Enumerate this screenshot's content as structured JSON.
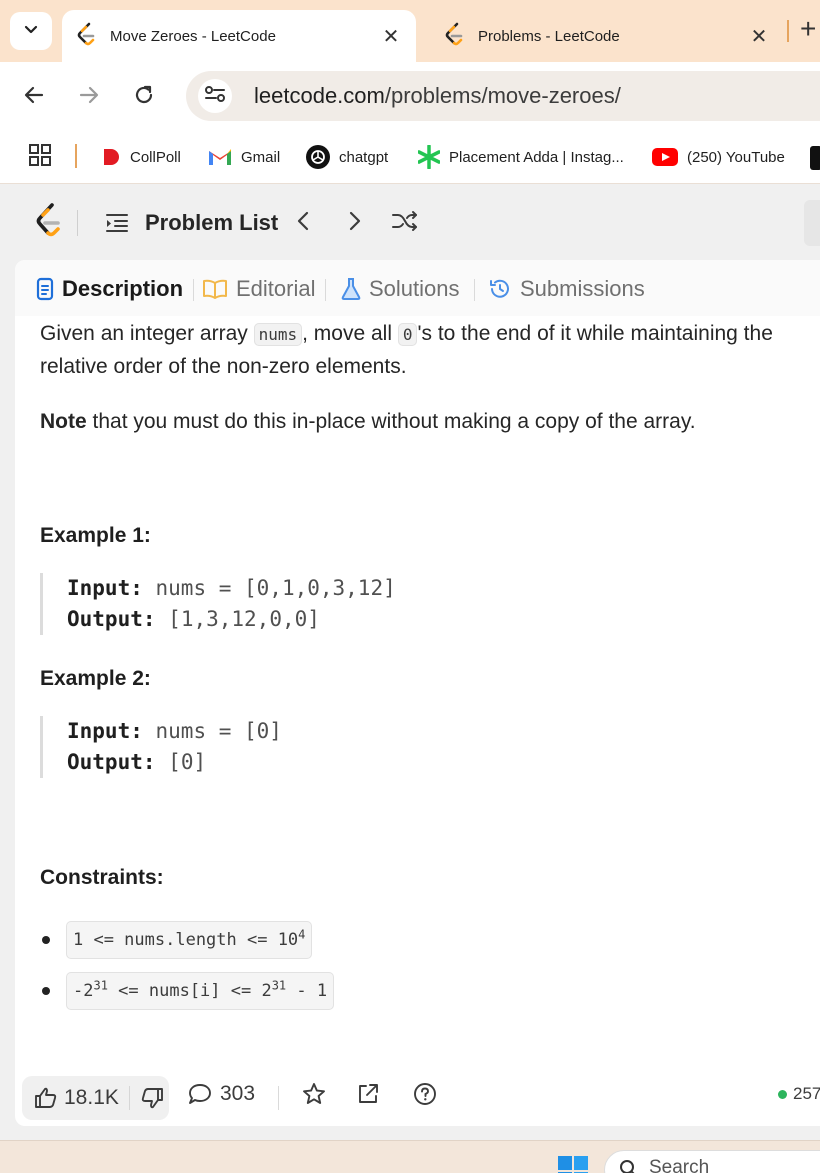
{
  "browser": {
    "tabs": [
      {
        "title": "Move Zeroes - LeetCode",
        "close": "✕"
      },
      {
        "title": "Problems - LeetCode",
        "close": "✕"
      }
    ],
    "new_tab": "+",
    "url_domain": "leetcode.com",
    "url_path": "/problems/move-zeroes/",
    "bookmarks": [
      "CollPoll",
      "Gmail",
      "chatgpt",
      "Placement Adda | Instag...",
      "(250) YouTube"
    ]
  },
  "leetcode": {
    "problem_list_label": "Problem List",
    "tabs": [
      "Description",
      "Editorial",
      "Solutions",
      "Submissions"
    ],
    "description": {
      "p1_a": "Given an integer array ",
      "p1_code1": "nums",
      "p1_b": ", move all ",
      "p1_code2": "0",
      "p1_c": "'s to the end of it while maintaining the relative order of the non-zero elements.",
      "note_bold": "Note",
      "note_rest": " that you must do this in-place without making a copy of the array."
    },
    "examples": [
      {
        "heading": "Example 1:",
        "input_label": "Input:",
        "input": "nums = [0,1,0,3,12]",
        "output_label": "Output:",
        "output": "[1,3,12,0,0]"
      },
      {
        "heading": "Example 2:",
        "input_label": "Input:",
        "input": "nums = [0]",
        "output_label": "Output:",
        "output": "[0]"
      }
    ],
    "constraints_heading": "Constraints:",
    "constraints": [
      {
        "pre": "1 <= nums.length <= 10",
        "sup": "4",
        "post": ""
      },
      {
        "pre": "-2",
        "sup": "31",
        "mid": " <= nums[i] <= 2",
        "sup2": "31",
        "post": " - 1"
      }
    ],
    "likes": "18.1K",
    "comments": "303",
    "online_count": "257"
  },
  "taskbar": {
    "search_placeholder": "Search"
  },
  "colors": {
    "accent_orange": "#ffa116",
    "tab_strip_bg": "#fbe3cc",
    "description_icon": "#1e6fd9",
    "online_green": "#2db55d"
  }
}
